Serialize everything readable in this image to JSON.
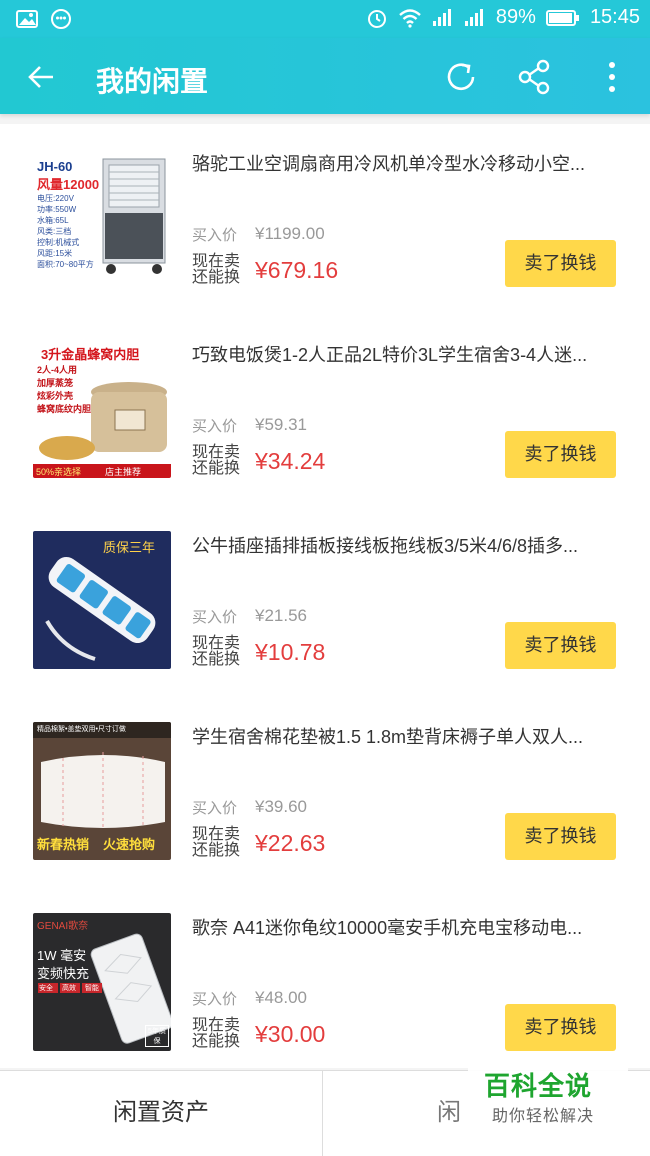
{
  "status_bar": {
    "battery": "89%",
    "time": "15:45"
  },
  "app_bar": {
    "title": "我的闲置"
  },
  "items": [
    {
      "title": "骆驼工业空调扇商用冷风机单冷型水冷移动小空...",
      "buy_label": "买入价",
      "buy_price": "¥1199.00",
      "now_label": "现在卖还能换",
      "now_price": "¥679.16",
      "sell_label": "卖了换钱",
      "thumb_text": {
        "model": "JH-60",
        "air": "风量12000",
        "specs": [
          "电压:220V",
          "功率:550W",
          "水箱:65L",
          "风类:三档",
          "控制:机械式",
          "风距:15米",
          "面积:70~80平方"
        ]
      }
    },
    {
      "title": "巧致电饭煲1-2人正品2L特价3L学生宿舍3-4人迷...",
      "buy_label": "买入价",
      "buy_price": "¥59.31",
      "now_label": "现在卖还能换",
      "now_price": "¥34.24",
      "sell_label": "卖了换钱",
      "thumb_text": {
        "headline": "3升金晶蜂窝内胆",
        "lines": [
          "2人-4人用",
          "加厚蒸笼",
          "炫彩外壳",
          "蜂窝底纹内胆"
        ],
        "footer_left": "50%亲选择",
        "footer_right": "店主推荐"
      }
    },
    {
      "title": "公牛插座插排插板接线板拖线板3/5米4/6/8插多...",
      "buy_label": "买入价",
      "buy_price": "¥21.56",
      "now_label": "现在卖还能换",
      "now_price": "¥10.78",
      "sell_label": "卖了换钱",
      "thumb_text": {
        "badge": "质保三年"
      }
    },
    {
      "title": "学生宿舍棉花垫被1.5 1.8m垫背床褥子单人双人...",
      "buy_label": "买入价",
      "buy_price": "¥39.60",
      "now_label": "现在卖还能换",
      "now_price": "¥22.63",
      "sell_label": "卖了换钱",
      "thumb_text": {
        "top": "精品棉絮•盖垫双用•尺寸订做",
        "bottom_left": "新春热销",
        "bottom_right": "火速抢购"
      }
    },
    {
      "title": "歌奈 A41迷你龟纹10000毫安手机充电宝移动电...",
      "buy_label": "买入价",
      "buy_price": "¥48.00",
      "now_label": "现在卖还能换",
      "now_price": "¥30.00",
      "sell_label": "卖了换钱",
      "thumb_text": {
        "brand": "GENAI歌奈",
        "line1": "1W 毫安",
        "line2": "变频快充",
        "tags": "安全 高效 智能",
        "warranty": "5年质保"
      }
    }
  ],
  "bottom_bar": {
    "tab_assets": "闲置资产",
    "tab_right": "闲"
  },
  "watermark": {
    "main": "百科全说",
    "sub": "助你轻松解决"
  },
  "colors": {
    "accent": "#25c8d8",
    "price_red": "#e33d3d",
    "button_yellow": "#ffd84a"
  }
}
